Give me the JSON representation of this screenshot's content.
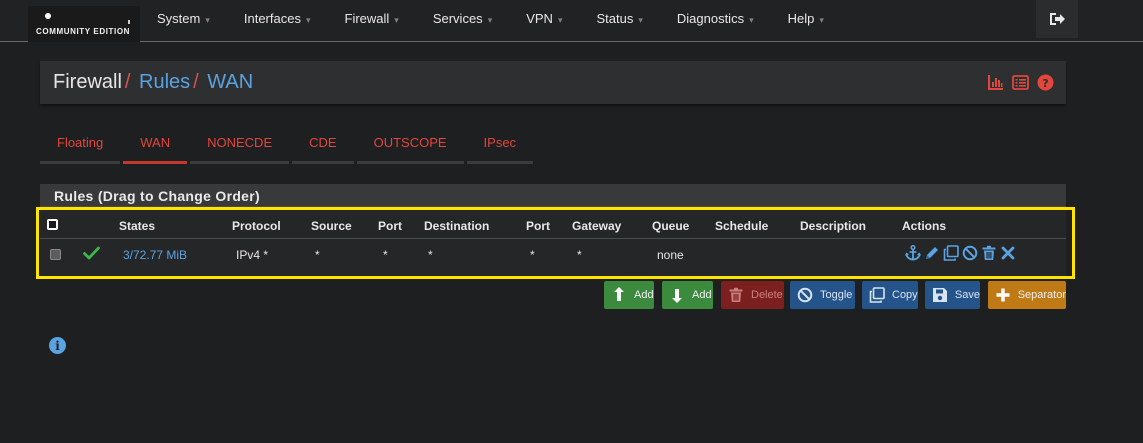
{
  "brand": {
    "subtitle": "COMMUNITY EDITION"
  },
  "navbar": {
    "menu": [
      {
        "label": "System"
      },
      {
        "label": "Interfaces"
      },
      {
        "label": "Firewall"
      },
      {
        "label": "Services"
      },
      {
        "label": "VPN"
      },
      {
        "label": "Status"
      },
      {
        "label": "Diagnostics"
      },
      {
        "label": "Help"
      }
    ],
    "logout_icon": "sign-out-icon"
  },
  "breadcrumb": {
    "items": [
      "Firewall",
      "Rules",
      "WAN"
    ],
    "separator": "/",
    "icons": [
      "bar-chart-icon",
      "list-icon",
      "question-circle-icon"
    ]
  },
  "tabs": [
    {
      "label": "Floating",
      "active": false
    },
    {
      "label": "WAN",
      "active": true
    },
    {
      "label": "NONECDE",
      "active": false
    },
    {
      "label": "CDE",
      "active": false
    },
    {
      "label": "OUTSCOPE",
      "active": false
    },
    {
      "label": "IPsec",
      "active": false
    }
  ],
  "rules": {
    "title": "Rules (Drag to Change Order)",
    "columns": [
      "States",
      "Protocol",
      "Source",
      "Port",
      "Destination",
      "Port",
      "Gateway",
      "Queue",
      "Schedule",
      "Description",
      "Actions"
    ],
    "rows": [
      {
        "status_icon": "check-icon",
        "states": "3/72.77 MiB",
        "protocol": "IPv4 *",
        "source": "*",
        "source_port": "*",
        "destination": "*",
        "destination_port": "*",
        "gateway": "*",
        "queue": "none",
        "schedule": "",
        "description": "",
        "action_icons": [
          "anchor-icon",
          "pencil-icon",
          "copy-icon",
          "ban-icon",
          "trash-icon",
          "times-icon"
        ]
      }
    ]
  },
  "buttons": {
    "add_top": "Add",
    "add_bottom": "Add",
    "delete": "Delete",
    "toggle": "Toggle",
    "copy": "Copy",
    "save": "Save",
    "separator": "Separator"
  },
  "colors": {
    "accent_red": "#d9534f",
    "link_blue": "#5aa3e0",
    "success_green": "#3b8a3e",
    "warning_orange": "#c07a15",
    "highlight_yellow": "#ffe400"
  },
  "info_icon": "info-circle-icon"
}
